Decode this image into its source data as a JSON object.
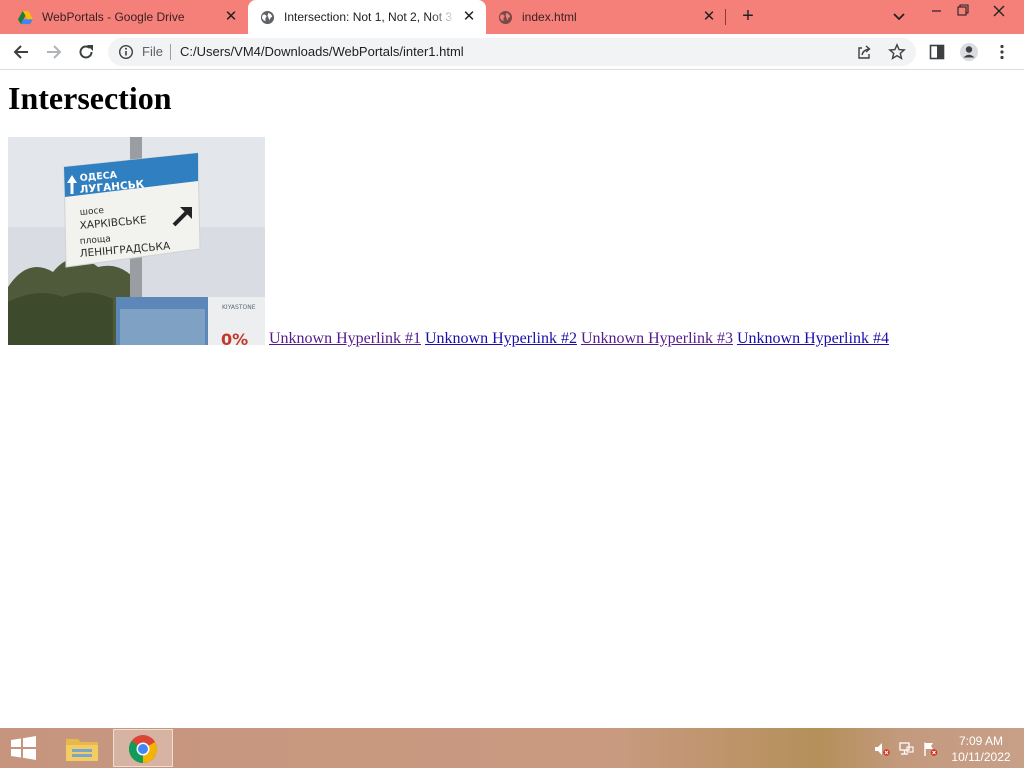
{
  "browser": {
    "tabs": [
      {
        "title": "WebPortals - Google Drive",
        "active": false,
        "icon": "google-drive-icon"
      },
      {
        "title": "Intersection: Not 1, Not 2, Not 3",
        "active": true,
        "icon": "globe-icon"
      },
      {
        "title": "index.html",
        "active": false,
        "icon": "globe-icon"
      }
    ],
    "new_tab_label": "+",
    "close_glyph": "✕",
    "omnibox": {
      "scheme_label": "File",
      "url": "C:/Users/VM4/Downloads/WebPortals/inter1.html"
    }
  },
  "page": {
    "heading": "Intersection",
    "image": {
      "description": "Road sign photo",
      "sign_lines": [
        "ОДЕСА",
        "ЛУГАНСЬК",
        "шосе",
        "ХАРКІВСЬКЕ",
        "площа",
        "ЛЕНІНГРАДСЬКА"
      ],
      "billboard_text": "0%"
    },
    "links": [
      "Unknown Hyperlink #1",
      "Unknown Hyperlink #2",
      "Unknown Hyperlink #3",
      "Unknown Hyperlink #4"
    ]
  },
  "taskbar": {
    "time": "7:09 AM",
    "date": "10/11/2022"
  },
  "colors": {
    "tab_strip": "#f5807a",
    "link": "#1a0dab",
    "link_visited": "#551a8b",
    "taskbar": "#c7957e"
  }
}
